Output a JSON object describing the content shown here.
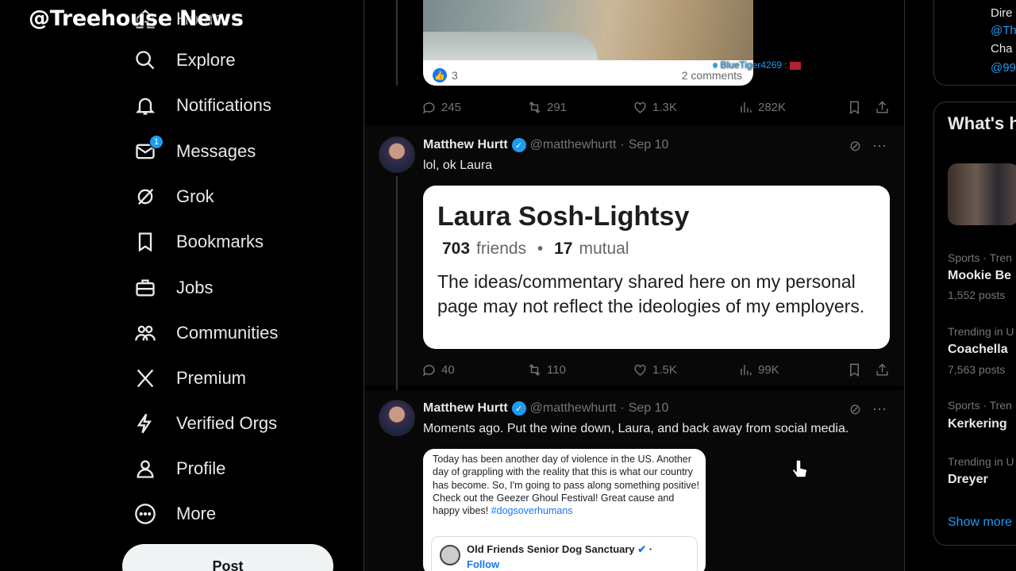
{
  "watermark": "@Treehouse News",
  "nav": {
    "items": [
      {
        "label": "Home",
        "icon": "home-icon"
      },
      {
        "label": "Explore",
        "icon": "search-icon"
      },
      {
        "label": "Notifications",
        "icon": "bell-icon"
      },
      {
        "label": "Messages",
        "icon": "envelope-icon",
        "badge": "1"
      },
      {
        "label": "Grok",
        "icon": "grok-icon"
      },
      {
        "label": "Bookmarks",
        "icon": "bookmark-icon"
      },
      {
        "label": "Jobs",
        "icon": "briefcase-icon"
      },
      {
        "label": "Communities",
        "icon": "people-icon"
      },
      {
        "label": "Premium",
        "icon": "x-logo-icon"
      },
      {
        "label": "Verified Orgs",
        "icon": "lightning-icon"
      },
      {
        "label": "Profile",
        "icon": "person-icon"
      },
      {
        "label": "More",
        "icon": "more-circle-icon"
      }
    ],
    "post_button": "Post"
  },
  "feed": {
    "prev_tweet": {
      "fb_likes": "3",
      "fb_comments": "2 comments",
      "chat_overlay": "BlueTiger4269 :",
      "stats": {
        "replies": "245",
        "reposts": "291",
        "likes": "1.3K",
        "views": "282K"
      }
    },
    "tweet1": {
      "name": "Matthew Hurtt",
      "handle": "@matthewhurtt",
      "date": "Sep 10",
      "text": "lol, ok Laura",
      "card": {
        "name": "Laura Sosh-Lightsy",
        "friends_count": "703",
        "friends_label": "friends",
        "mutual_count": "17",
        "mutual_label": "mutual",
        "bio": "The ideas/commentary shared here on my personal page may not reflect the ideologies of my employers."
      },
      "stats": {
        "replies": "40",
        "reposts": "110",
        "likes": "1.5K",
        "views": "99K"
      }
    },
    "tweet2": {
      "name": "Matthew Hurtt",
      "handle": "@matthewhurtt",
      "date": "Sep 10",
      "text": "Moments ago. Put the wine down, Laura, and back away from social media.",
      "fb_post": {
        "text": "Today has been another day of violence in the US. Another day of grappling with the reality that this is what our country has become. So, I'm going to pass along something positive! Check out the Geezer Ghoul Festival! Great cause and happy vibes!",
        "hashtag": "#dogsoverhumans",
        "page_name": "Old Friends Senior Dog Sanctuary",
        "follow": "Follow"
      }
    }
  },
  "right": {
    "top_lines": [
      "Dire",
      "@Th",
      "Cha",
      "@99"
    ],
    "whats_happening": "What's h",
    "trends": [
      {
        "context": "Sports · Tren",
        "name": "Mookie Be",
        "posts": "1,552 posts"
      },
      {
        "context": "Trending in U",
        "name": "Coachella",
        "posts": "7,563 posts"
      },
      {
        "context": "Sports · Tren",
        "name": "Kerkering",
        "posts": ""
      },
      {
        "context": "Trending in U",
        "name": "Dreyer",
        "posts": ""
      }
    ],
    "show_more": "Show more"
  }
}
